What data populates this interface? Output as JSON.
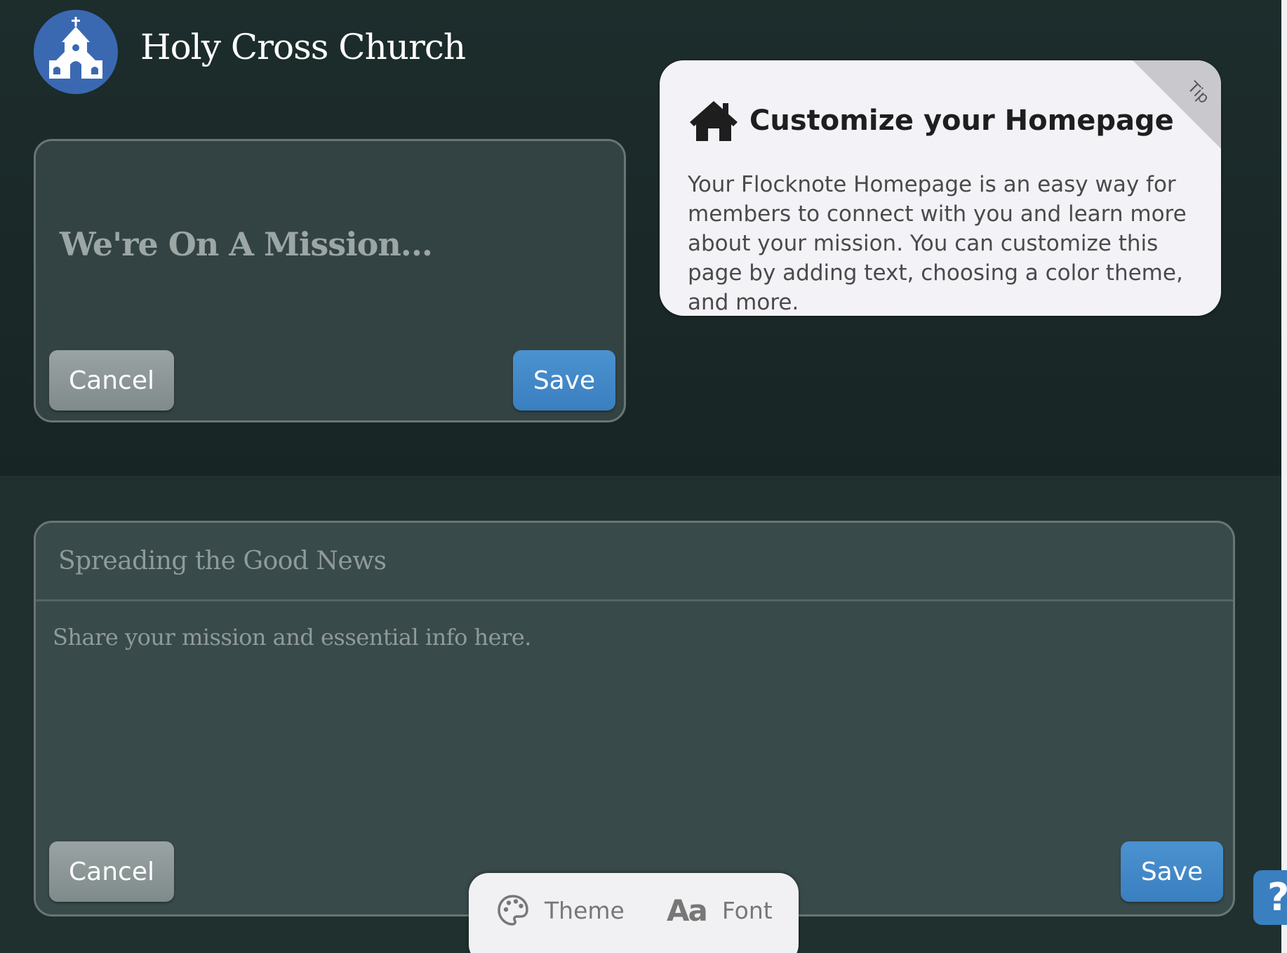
{
  "header": {
    "church_name": "Holy Cross Church",
    "logo_icon": "church-icon"
  },
  "mission_card": {
    "title": "We're On A Mission...",
    "cancel_label": "Cancel",
    "save_label": "Save"
  },
  "tip": {
    "corner_label": "Tip",
    "icon": "home-icon",
    "heading": "Customize your Homepage",
    "body": "Your Flocknote Homepage is an easy way for members to connect with you and learn more about your mission. You can customize this page by adding text, choosing a color theme, and more."
  },
  "content_card": {
    "title": "Spreading the Good News",
    "placeholder": "Share your mission and essential info here.",
    "cancel_label": "Cancel",
    "save_label": "Save"
  },
  "toolbar": {
    "theme_label": "Theme",
    "theme_icon": "palette-icon",
    "font_glyph": "Aa",
    "font_label": "Font"
  },
  "help": {
    "label": "?"
  },
  "colors": {
    "accent_blue": "#3a7fc0",
    "logo_blue": "#3a69b2",
    "background_dark": "#1b2727",
    "card_background": "#334343",
    "tip_background": "#f3f2f6"
  }
}
